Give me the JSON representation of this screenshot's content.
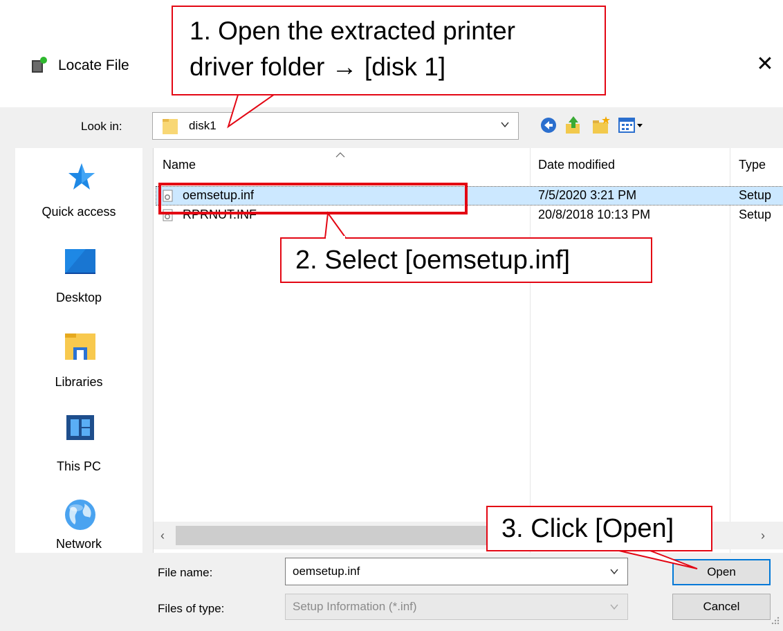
{
  "window": {
    "title": "Locate File",
    "close_glyph": "✕"
  },
  "lookin": {
    "label": "Look in:",
    "value": "disk1",
    "icon": "folder-icon"
  },
  "toolbar_icons": [
    "back-icon",
    "up-folder-icon",
    "new-folder-icon",
    "view-menu-icon"
  ],
  "places": [
    {
      "label": "Quick access",
      "icon": "quick-access-star-icon"
    },
    {
      "label": "Desktop",
      "icon": "desktop-icon"
    },
    {
      "label": "Libraries",
      "icon": "libraries-icon"
    },
    {
      "label": "This PC",
      "icon": "this-pc-icon"
    },
    {
      "label": "Network",
      "icon": "network-globe-icon"
    }
  ],
  "columns": {
    "name": "Name",
    "date": "Date modified",
    "type": "Type"
  },
  "files": [
    {
      "name": "oemsetup.inf",
      "date": "7/5/2020 3:21 PM",
      "type": "Setup",
      "selected": true
    },
    {
      "name": "RPRNUT.INF",
      "date": "20/8/2018 10:13 PM",
      "type": "Setup",
      "selected": false
    }
  ],
  "scroll": {
    "left": "‹",
    "right": "›"
  },
  "filename": {
    "label": "File name:",
    "value": "oemsetup.inf"
  },
  "filetype": {
    "label": "Files of type:",
    "value": "Setup Information (*.inf)"
  },
  "buttons": {
    "open": "Open",
    "cancel": "Cancel"
  },
  "callouts": {
    "step1_line1": "1. Open the extracted printer",
    "step1_line2": "driver folder → [disk 1]",
    "step2": "2. Select [oemsetup.inf]",
    "step3": "3. Click [Open]"
  },
  "colors": {
    "accent_red": "#e30613",
    "selection": "#cce8ff",
    "focus_blue": "#0078d7"
  }
}
